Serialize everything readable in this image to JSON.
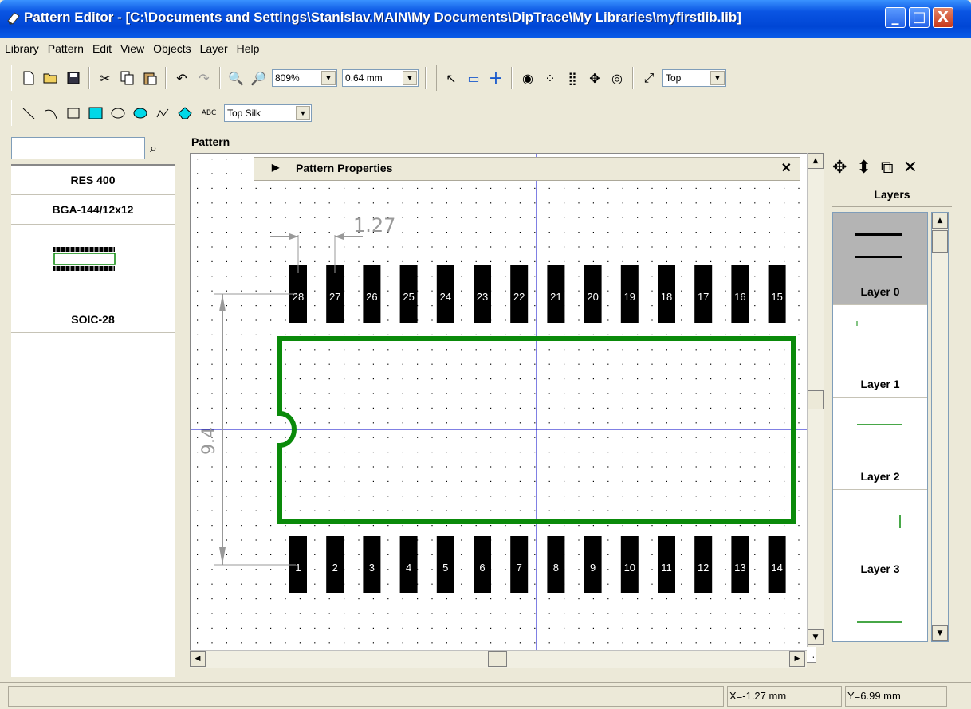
{
  "window": {
    "title": "Pattern Editor - [C:\\Documents and Settings\\Stanislav.MAIN\\My Documents\\DipTrace\\My Libraries\\myfirstlib.lib]",
    "min_label": "_",
    "max_label": "□",
    "close_label": "X"
  },
  "menu": {
    "items": [
      "Library",
      "Pattern",
      "Edit",
      "View",
      "Objects",
      "Layer",
      "Help"
    ]
  },
  "toolbar": {
    "zoom_value": "809%",
    "grid_value": "0.64 mm",
    "side_value": "Top",
    "layer_value": "Top Silk",
    "text_tool_label": "ABC"
  },
  "library": {
    "search_value": "",
    "items": [
      {
        "name": "RES 400"
      },
      {
        "name": "BGA-144/12x12"
      }
    ],
    "preview_name": "SOIC-28"
  },
  "pattern": {
    "section_label": "Pattern",
    "properties_title": "Pattern Properties",
    "dim_horizontal": "1.27",
    "dim_vertical": "9.4",
    "top_pads": [
      "28",
      "27",
      "26",
      "25",
      "24",
      "23",
      "22",
      "21",
      "20",
      "19",
      "18",
      "17",
      "16",
      "15"
    ],
    "bottom_pads": [
      "1",
      "2",
      "3",
      "4",
      "5",
      "6",
      "7",
      "8",
      "9",
      "10",
      "11",
      "12",
      "13",
      "14"
    ],
    "outline_color": "#0a8a0a",
    "crosshair_color": "#0000c8",
    "pad_color": "#000000"
  },
  "layers": {
    "title": "Layers",
    "items": [
      {
        "name": "Layer 0",
        "selected": true
      },
      {
        "name": "Layer 1",
        "selected": false
      },
      {
        "name": "Layer 2",
        "selected": false
      },
      {
        "name": "Layer 3",
        "selected": false
      },
      {
        "name": "",
        "selected": false
      }
    ]
  },
  "status": {
    "x": "X=-1.27 mm",
    "y": "Y=6.99 mm"
  }
}
